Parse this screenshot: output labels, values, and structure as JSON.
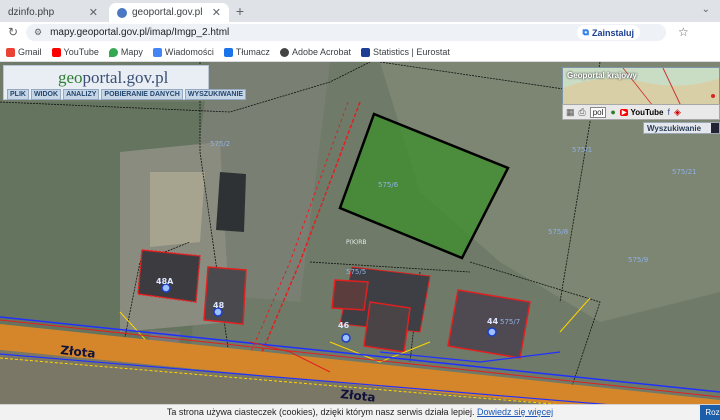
{
  "browser": {
    "tabs": [
      {
        "label": "dzinfo.php",
        "active": false
      },
      {
        "label": "geoportal.gov.pl",
        "active": true
      }
    ],
    "new_tab": "+",
    "tab_menu": "⌄",
    "address": "mapy.geoportal.gov.pl/imap/Imgp_2.html",
    "install_label": "Zainstaluj",
    "bookmarks": [
      "Gmail",
      "YouTube",
      "Mapy",
      "Wiadomości",
      "Tłumacz",
      "Adobe Acrobat",
      "Statistics | Eurostat"
    ]
  },
  "geoportal": {
    "logo_prefix": "geo",
    "logo_rest": "portal.gov.pl",
    "menu": [
      "PLIK",
      "WIDOK",
      "ANALIZY",
      "POBIERANIE DANYCH",
      "WYSZUKIWANIE"
    ],
    "minimap_title": "Geoportal krajowy",
    "language": "pol",
    "youtube_label": "YouTube",
    "search_panel": "Wyszukiwanie"
  },
  "map": {
    "parcel_labels": [
      "575/2",
      "575/1",
      "575/6",
      "575/8",
      "575/5",
      "575/7",
      "575/21",
      "575/9",
      "575/3",
      "575/4"
    ],
    "address_points": [
      "48A",
      "48",
      "46",
      "44"
    ],
    "street": "Złota",
    "street2": "Złota",
    "usage_label": "P(K)RB",
    "colors": {
      "selected_parcel": "#000000",
      "buildings": "#e02020",
      "water": "#2030ff",
      "gas": "#ffd000",
      "road": "#e08a1a"
    }
  },
  "cookie": {
    "text": "Ta strona używa ciasteczek (cookies), dzięki którym nasz serwis działa lepiej.",
    "link": "Dowiedz się więcej",
    "button": "Roz"
  }
}
